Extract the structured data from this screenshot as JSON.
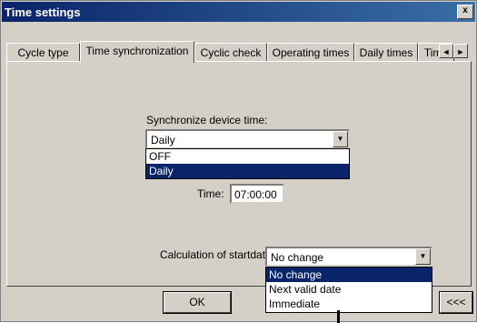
{
  "window": {
    "title": "Time settings",
    "close_label": "x"
  },
  "tabs": [
    {
      "label": "Cycle type"
    },
    {
      "label": "Time synchronization"
    },
    {
      "label": "Cyclic check"
    },
    {
      "label": "Operating times"
    },
    {
      "label": "Daily times"
    },
    {
      "label": "Time"
    }
  ],
  "tab_scroll": {
    "left": "◄",
    "right": "►"
  },
  "sync": {
    "label": "Synchronize device time:",
    "value": "Daily",
    "options": [
      "OFF",
      "Daily"
    ],
    "selected_option": "Daily"
  },
  "time": {
    "label": "Time:",
    "value": "07:00:00"
  },
  "startdate": {
    "label": "Calculation of startdate:",
    "value": "No change",
    "options": [
      "No change",
      "Next valid date",
      "Immediate"
    ],
    "selected_option": "No change"
  },
  "buttons": {
    "ok": "OK",
    "more": "<<<"
  },
  "icons": {
    "dropdown_arrow": "▼"
  }
}
